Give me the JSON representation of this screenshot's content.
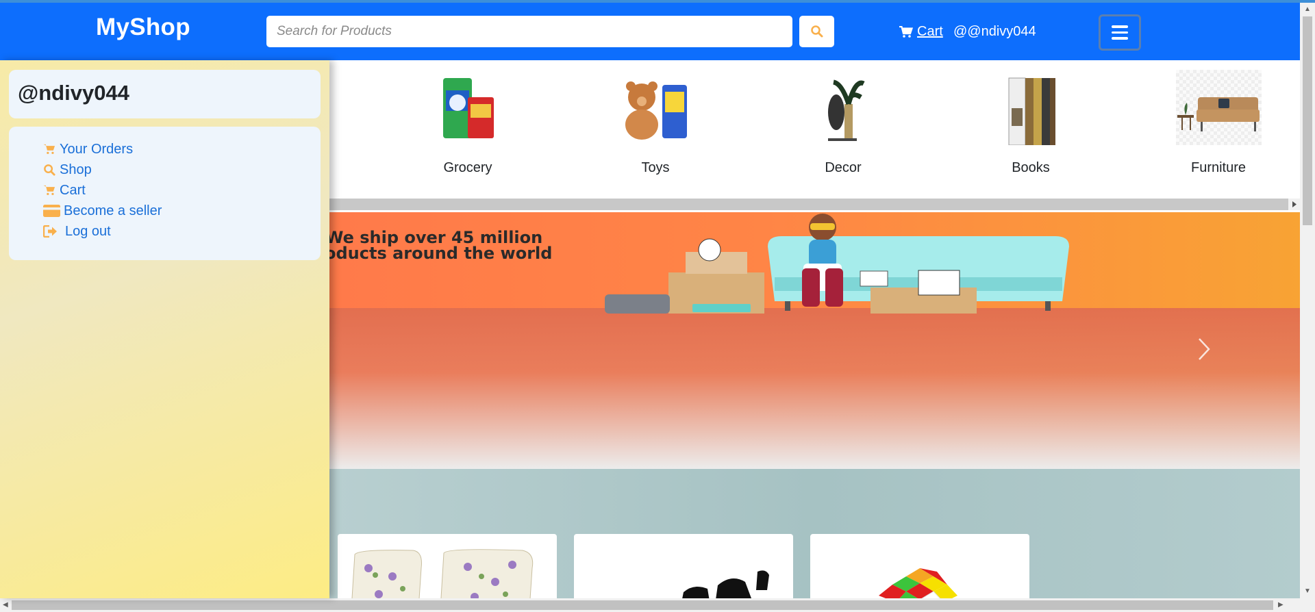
{
  "navbar": {
    "brand": "MyShop",
    "search_placeholder": "Search for Products",
    "search_icon": "search-icon",
    "cart_label": "Cart",
    "user_handle": "@@ndivy044",
    "menu_icon": "hamburger-menu-icon"
  },
  "sidebar": {
    "username": "@ndivy044",
    "items": [
      {
        "label": "Your Orders",
        "icon": "cart-icon"
      },
      {
        "label": "Shop",
        "icon": "search-icon"
      },
      {
        "label": "Cart",
        "icon": "cart-icon"
      },
      {
        "label": "Become a seller",
        "icon": "credit-card-icon"
      },
      {
        "label": "Log out",
        "icon": "logout-icon"
      }
    ]
  },
  "categories": [
    {
      "name": "Grocery"
    },
    {
      "name": "Toys"
    },
    {
      "name": "Decor"
    },
    {
      "name": "Books"
    },
    {
      "name": "Furniture"
    }
  ],
  "banner": {
    "line1": "We ship over 45 million",
    "line2": "products around the world"
  },
  "colors": {
    "primary": "#0d6efd",
    "accent_orange": "#f9b04c",
    "link_blue": "#1a6fd8"
  }
}
